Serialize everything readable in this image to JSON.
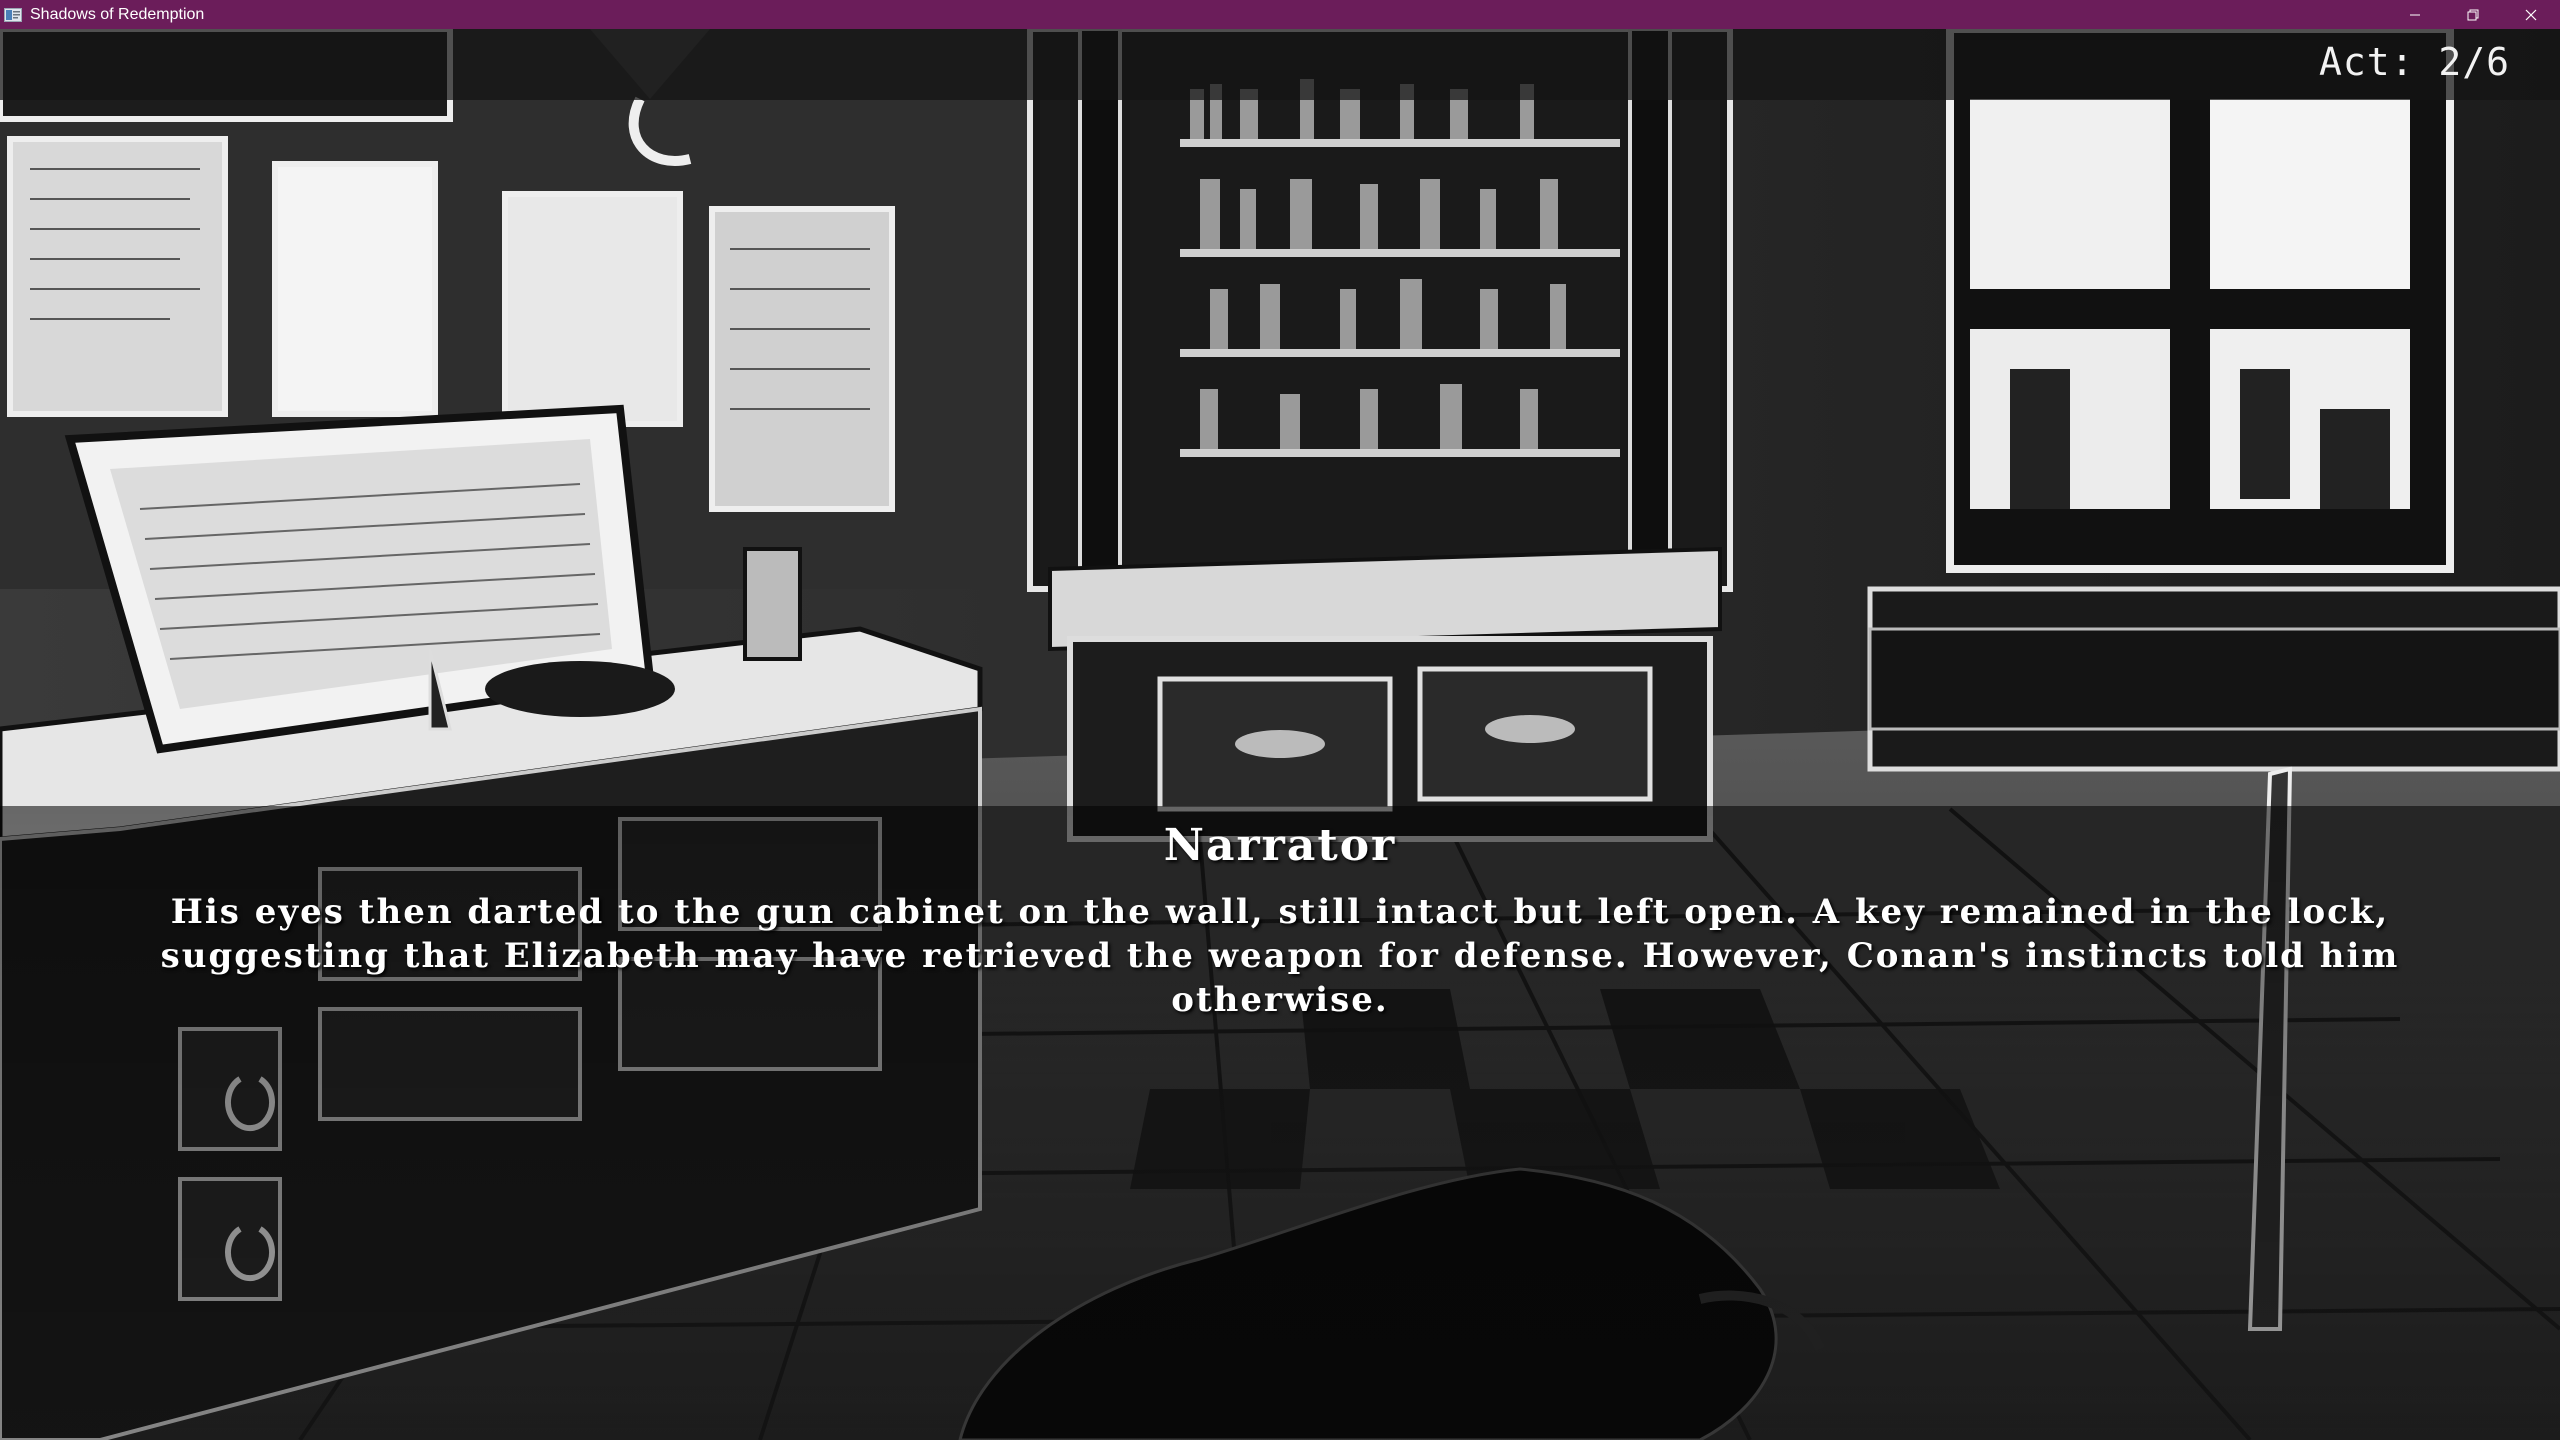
{
  "window": {
    "title": "Shadows of Redemption",
    "titlebar_color": "#6b1d5a",
    "controls": [
      "minimize-icon",
      "restore-icon",
      "close-icon"
    ]
  },
  "hud": {
    "act": "Act: 2/6"
  },
  "dialogue": {
    "speaker": "Narrator",
    "text": "His eyes then darted to the gun cabinet on the wall, still intact but left open. A key remained in the lock, suggesting that Elizabeth may have retrieved the weapon for defense. However, Conan's instincts told him otherwise."
  }
}
